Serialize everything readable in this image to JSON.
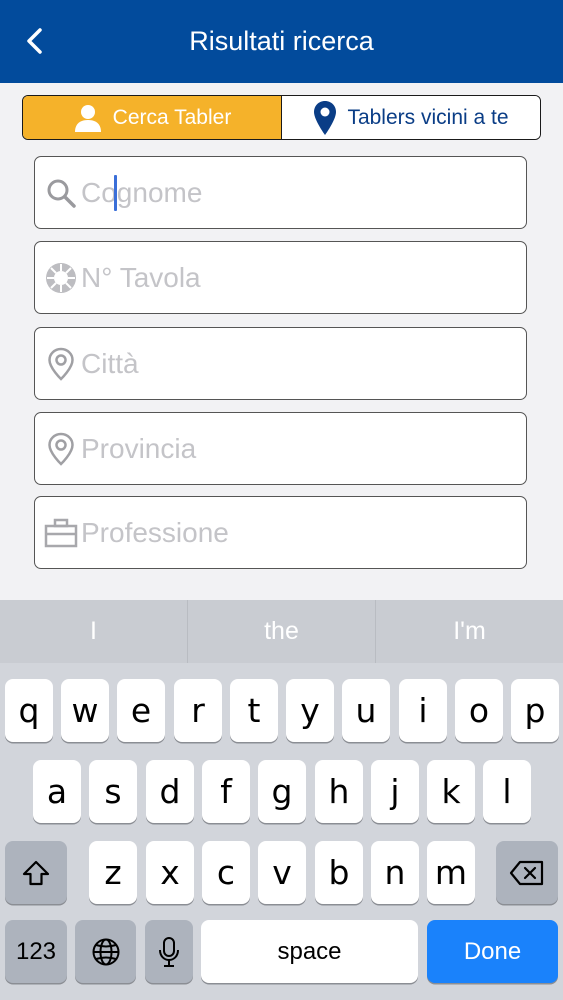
{
  "header": {
    "title": "Risultati ricerca",
    "back_icon": "chevron-left-icon"
  },
  "segment": {
    "active": {
      "label": "Cerca Tabler",
      "icon": "person-icon"
    },
    "inactive": {
      "label": "Tablers vicini a te",
      "icon": "location-pin-icon"
    }
  },
  "fields": {
    "cognome": {
      "placeholder": "Cognome",
      "icon": "search-icon"
    },
    "tavola": {
      "placeholder": "N° Tavola",
      "icon": "round-table-emblem-icon"
    },
    "citta": {
      "placeholder": "Città",
      "icon": "location-pin-outline-icon"
    },
    "provincia": {
      "placeholder": "Provincia",
      "icon": "location-pin-outline-icon"
    },
    "professione": {
      "placeholder": "Professione",
      "icon": "briefcase-icon"
    }
  },
  "keyboard": {
    "suggestions": [
      "I",
      "the",
      "I'm"
    ],
    "row1": [
      "q",
      "w",
      "e",
      "r",
      "t",
      "y",
      "u",
      "i",
      "o",
      "p"
    ],
    "row2": [
      "a",
      "s",
      "d",
      "f",
      "g",
      "h",
      "j",
      "k",
      "l"
    ],
    "row3": [
      "z",
      "x",
      "c",
      "v",
      "b",
      "n",
      "m"
    ],
    "numbers_label": "123",
    "space_label": "space",
    "done_label": "Done"
  },
  "colors": {
    "header": "#024b9c",
    "accent": "#f5b22a",
    "done": "#1a82fb"
  }
}
